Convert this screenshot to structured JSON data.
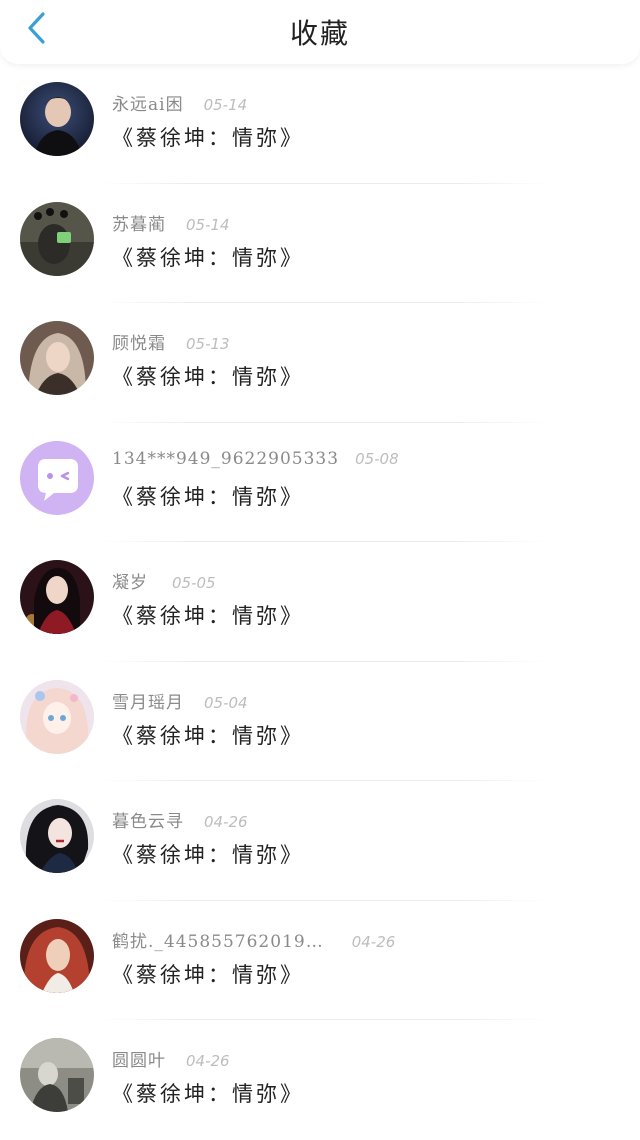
{
  "header": {
    "title": "收藏",
    "back_icon": "chevron-left-icon",
    "accent_color": "#3a9fd8"
  },
  "favorites": [
    {
      "username": "永远ai困",
      "date": "05-14",
      "title": "《蔡徐坤：情弥》",
      "avatar_color": "#1f2a44"
    },
    {
      "username": "苏暮蔺",
      "date": "05-14",
      "title": "《蔡徐坤：情弥》",
      "avatar_color": "#4a4a3c"
    },
    {
      "username": "顾悦霜",
      "date": "05-13",
      "title": "《蔡徐坤：情弥》",
      "avatar_color": "#5b4a42"
    },
    {
      "username": "134***949_9622905333",
      "date": "05-08",
      "title": "《蔡徐坤：情弥》",
      "avatar_color": "#c9a8f0"
    },
    {
      "username": "凝岁",
      "date": "05-05",
      "title": "《蔡徐坤：情弥》",
      "avatar_color": "#3c1a22"
    },
    {
      "username": "雪月瑶月",
      "date": "05-04",
      "title": "《蔡徐坤：情弥》",
      "avatar_color": "#e9d8e4"
    },
    {
      "username": "暮色云寻",
      "date": "04-26",
      "title": "《蔡徐坤：情弥》",
      "avatar_color": "#2b2b33"
    },
    {
      "username": "鹤扰._445855762019…",
      "date": "04-26",
      "title": "《蔡徐坤：情弥》",
      "avatar_color": "#9e3a2e"
    },
    {
      "username": "圆圆叶",
      "date": "04-26",
      "title": "《蔡徐坤：情弥》",
      "avatar_color": "#6b6b66"
    }
  ]
}
